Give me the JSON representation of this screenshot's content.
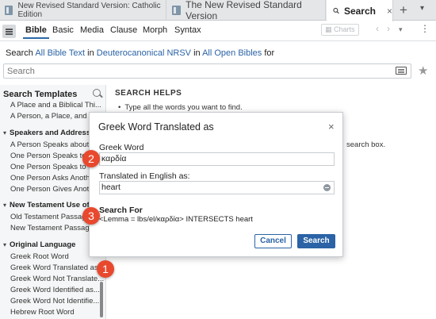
{
  "tabs": [
    {
      "label": "New Revised Standard Version: Catholic Edition",
      "active": false
    },
    {
      "label": "The New Revised Standard Version",
      "active": false
    },
    {
      "label": "Search",
      "active": true,
      "close": "×"
    }
  ],
  "toolbar": {
    "kinds": [
      "Bible",
      "Basic",
      "Media",
      "Clause",
      "Morph",
      "Syntax"
    ],
    "active_kind": "Bible",
    "charts_label": "Charts"
  },
  "search_line": {
    "prefix": "Search",
    "scope": "All Bible Text",
    "in1": "in",
    "resource": "Deuterocanonical NRSV",
    "in2": "in",
    "collection": "All Open Bibles",
    "suffix": "for"
  },
  "search_input": {
    "placeholder": "Search"
  },
  "left_panel": {
    "title": "Search Templates",
    "items": [
      {
        "type": "item",
        "label": "A Place and a Biblical Thi..."
      },
      {
        "type": "item",
        "label": "A Person, a Place, and a B"
      },
      {
        "type": "group",
        "label": "Speakers and Addressees"
      },
      {
        "type": "item",
        "label": "A Person Speaks about S..."
      },
      {
        "type": "item",
        "label": "One Person Speaks to"
      },
      {
        "type": "item",
        "label": "One Person Speaks to"
      },
      {
        "type": "item",
        "label": "One Person Asks Another"
      },
      {
        "type": "item",
        "label": "One Person Gives Anothe"
      },
      {
        "type": "group",
        "label": "New Testament Use of th"
      },
      {
        "type": "item",
        "label": "Old Testament Passage"
      },
      {
        "type": "item",
        "label": "New Testament Passage"
      },
      {
        "type": "group",
        "label": "Original Language"
      },
      {
        "type": "item",
        "label": "Greek Root Word"
      },
      {
        "type": "item",
        "label": "Greek Word Translated as"
      },
      {
        "type": "item",
        "label": "Greek Word Not Translate..."
      },
      {
        "type": "item",
        "label": "Greek Word Identified as..."
      },
      {
        "type": "item",
        "label": "Greek Word Not Identifie..."
      },
      {
        "type": "item",
        "label": "Hebrew Root Word"
      }
    ]
  },
  "helps": {
    "title": "SEARCH HELPS",
    "bullet": "Type all the words you want to find.",
    "tail": "search box."
  },
  "dialog": {
    "title": "Greek Word Translated as",
    "close": "×",
    "greek_label": "Greek Word",
    "greek_value": "καρδία",
    "english_label": "Translated in English as:",
    "english_value": "heart",
    "search_for_label": "Search For",
    "query": "<Lemma = lbs/el/καρδία> INTERSECTS heart",
    "cancel_label": "Cancel",
    "search_label": "Search"
  },
  "callouts": [
    "1",
    "2",
    "3"
  ],
  "colors": {
    "accent": "#2b63a6",
    "callout": "#e8492e"
  }
}
